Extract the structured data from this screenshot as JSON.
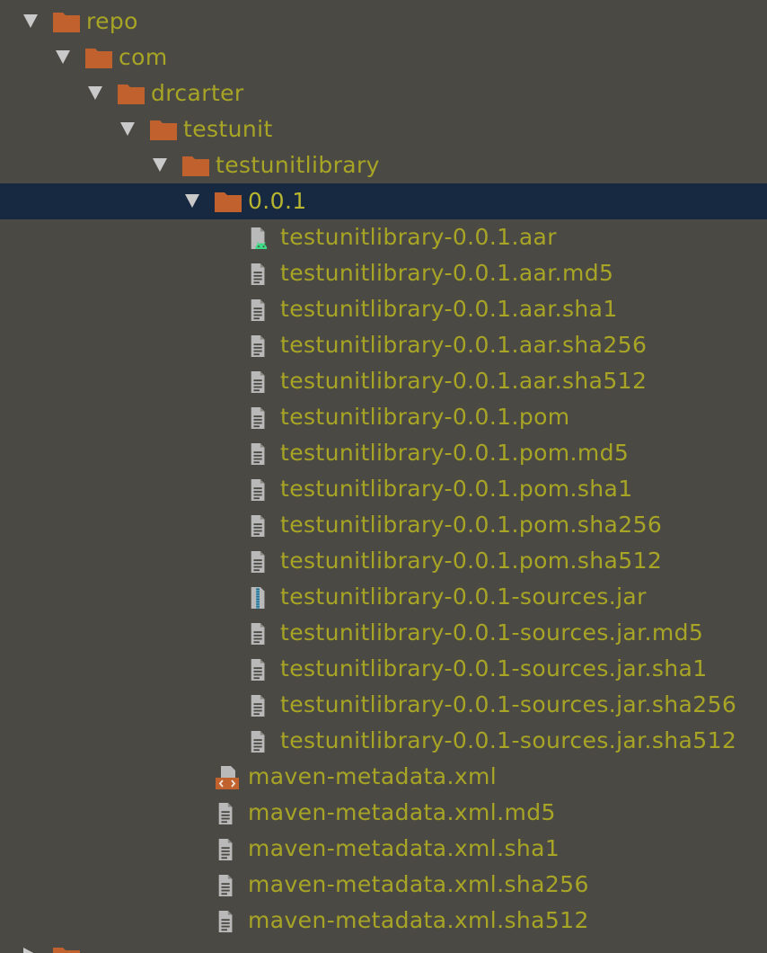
{
  "tree": {
    "folders": [
      {
        "label": "repo",
        "icon": "folder-icon",
        "expanded": true
      },
      {
        "label": "com",
        "icon": "folder-icon",
        "expanded": true
      },
      {
        "label": "drcarter",
        "icon": "folder-icon",
        "expanded": true
      },
      {
        "label": "testunit",
        "icon": "folder-icon",
        "expanded": true
      },
      {
        "label": "testunitlibrary",
        "icon": "folder-icon",
        "expanded": true
      },
      {
        "label": "0.0.1",
        "icon": "folder-icon",
        "expanded": true,
        "selected": true
      },
      {
        "label": "",
        "icon": "folder-icon",
        "expanded": false
      }
    ],
    "version_files": [
      {
        "label": "testunitlibrary-0.0.1.aar",
        "icon": "android-archive-icon"
      },
      {
        "label": "testunitlibrary-0.0.1.aar.md5",
        "icon": "text-file-icon"
      },
      {
        "label": "testunitlibrary-0.0.1.aar.sha1",
        "icon": "text-file-icon"
      },
      {
        "label": "testunitlibrary-0.0.1.aar.sha256",
        "icon": "text-file-icon"
      },
      {
        "label": "testunitlibrary-0.0.1.aar.sha512",
        "icon": "text-file-icon"
      },
      {
        "label": "testunitlibrary-0.0.1.pom",
        "icon": "text-file-icon"
      },
      {
        "label": "testunitlibrary-0.0.1.pom.md5",
        "icon": "text-file-icon"
      },
      {
        "label": "testunitlibrary-0.0.1.pom.sha1",
        "icon": "text-file-icon"
      },
      {
        "label": "testunitlibrary-0.0.1.pom.sha256",
        "icon": "text-file-icon"
      },
      {
        "label": "testunitlibrary-0.0.1.pom.sha512",
        "icon": "text-file-icon"
      },
      {
        "label": "testunitlibrary-0.0.1-sources.jar",
        "icon": "archive-file-icon"
      },
      {
        "label": "testunitlibrary-0.0.1-sources.jar.md5",
        "icon": "text-file-icon"
      },
      {
        "label": "testunitlibrary-0.0.1-sources.jar.sha1",
        "icon": "text-file-icon"
      },
      {
        "label": "testunitlibrary-0.0.1-sources.jar.sha256",
        "icon": "text-file-icon"
      },
      {
        "label": "testunitlibrary-0.0.1-sources.jar.sha512",
        "icon": "text-file-icon"
      }
    ],
    "library_files": [
      {
        "label": "maven-metadata.xml",
        "icon": "xml-file-icon"
      },
      {
        "label": "maven-metadata.xml.md5",
        "icon": "text-file-icon"
      },
      {
        "label": "maven-metadata.xml.sha1",
        "icon": "text-file-icon"
      },
      {
        "label": "maven-metadata.xml.sha256",
        "icon": "text-file-icon"
      },
      {
        "label": "maven-metadata.xml.sha512",
        "icon": "text-file-icon"
      }
    ]
  },
  "colors": {
    "background": "#4a4943",
    "selection": "#172941",
    "label": "#a8a526",
    "folder": "#c1622e",
    "arrow": "#c9c9c9",
    "file_icon": "#b9b9b9",
    "android": "#3ddc84",
    "archive_zipper": "#4fa3c7",
    "xml_badge": "#c1622e"
  }
}
